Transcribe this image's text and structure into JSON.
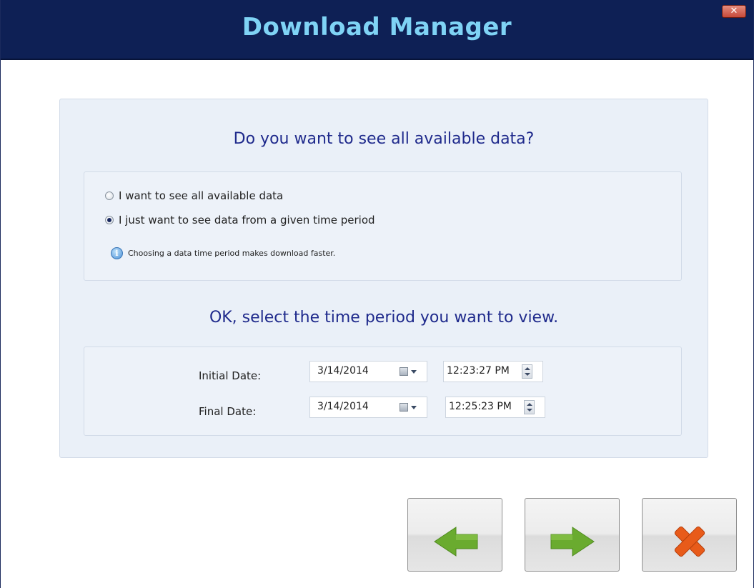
{
  "window": {
    "title": "Download Manager",
    "close_glyph": "✕"
  },
  "question": "Do you want to see all available data?",
  "options": [
    {
      "label": "I want to see all available data",
      "selected": false
    },
    {
      "label": "I just want to see data from a given time period",
      "selected": true
    }
  ],
  "info": {
    "icon": "info-icon",
    "glyph": "i",
    "text": "Choosing a data time period makes download faster."
  },
  "prompt": "OK, select the time period you want to view.",
  "initial": {
    "label": "Initial Date:",
    "date": "3/14/2014",
    "time": "12:23:27 PM"
  },
  "final": {
    "label": "Final Date:",
    "date": "3/14/2014",
    "time": "12:25:23 PM"
  },
  "buttons": {
    "back": {
      "icon": "left-arrow-icon",
      "color": "#6aab2f"
    },
    "next": {
      "icon": "right-arrow-icon",
      "color": "#6aab2f"
    },
    "cancel": {
      "icon": "cancel-x-icon",
      "color": "#e85b1a"
    }
  },
  "colors": {
    "titlebar": "#0e2055",
    "title_text": "#7fd3f5",
    "heading_text": "#1f2a8c",
    "panel_bg": "#eaf0f8"
  }
}
